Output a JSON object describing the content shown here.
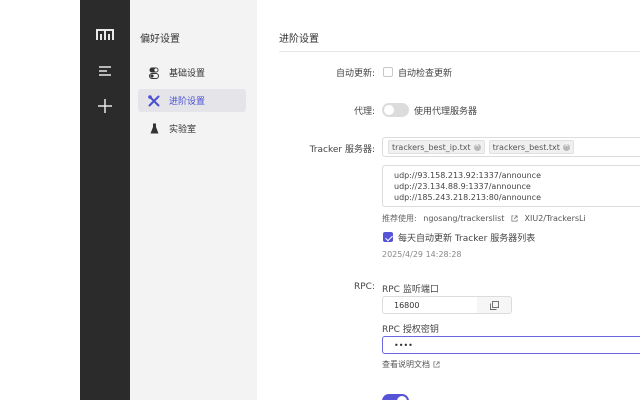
{
  "rail": {
    "logo_icon": "app-logo-m",
    "menu_icon": "hamburger-menu",
    "add_icon": "plus"
  },
  "sidebar": {
    "title": "偏好设置",
    "items": [
      {
        "label": "基础设置",
        "icon": "toggle-switch",
        "active": false
      },
      {
        "label": "进阶设置",
        "icon": "wrench-screwdriver",
        "active": true
      },
      {
        "label": "实验室",
        "icon": "flask",
        "active": false
      }
    ]
  },
  "main": {
    "title": "进阶设置",
    "auto_update": {
      "label": "自动更新:",
      "option": "自动检查更新",
      "checked": false
    },
    "proxy": {
      "label": "代理:",
      "option": "使用代理服务器",
      "enabled": false
    },
    "tracker": {
      "label": "Tracker 服务器:",
      "tags": [
        "trackers_best_ip.txt",
        "trackers_best.txt"
      ],
      "urls": [
        "udp://93.158.213.92:1337/announce",
        "udp://23.134.88.9:1337/announce",
        "udp://185.243.218.213:80/announce"
      ],
      "recommend_label": "推荐使用:",
      "recommend_links": [
        "ngosang/trackerslist",
        "XIU2/TrackersLi"
      ],
      "daily_update_option": "每天自动更新 Tracker 服务器列表",
      "daily_update_checked": true,
      "last_update": "2025/4/29 14:28:28"
    },
    "rpc": {
      "label": "RPC:",
      "port_label": "RPC 监听端口",
      "port_value": "16800",
      "secret_label": "RPC 授权密钥",
      "secret_value": "••••",
      "docs_link": "查看说明文档"
    }
  },
  "colors": {
    "accent": "#5653d6",
    "rail_bg": "#2b2b2b",
    "sidebar_bg": "#f3f3f3",
    "active_item_bg": "#e4e4e9"
  }
}
